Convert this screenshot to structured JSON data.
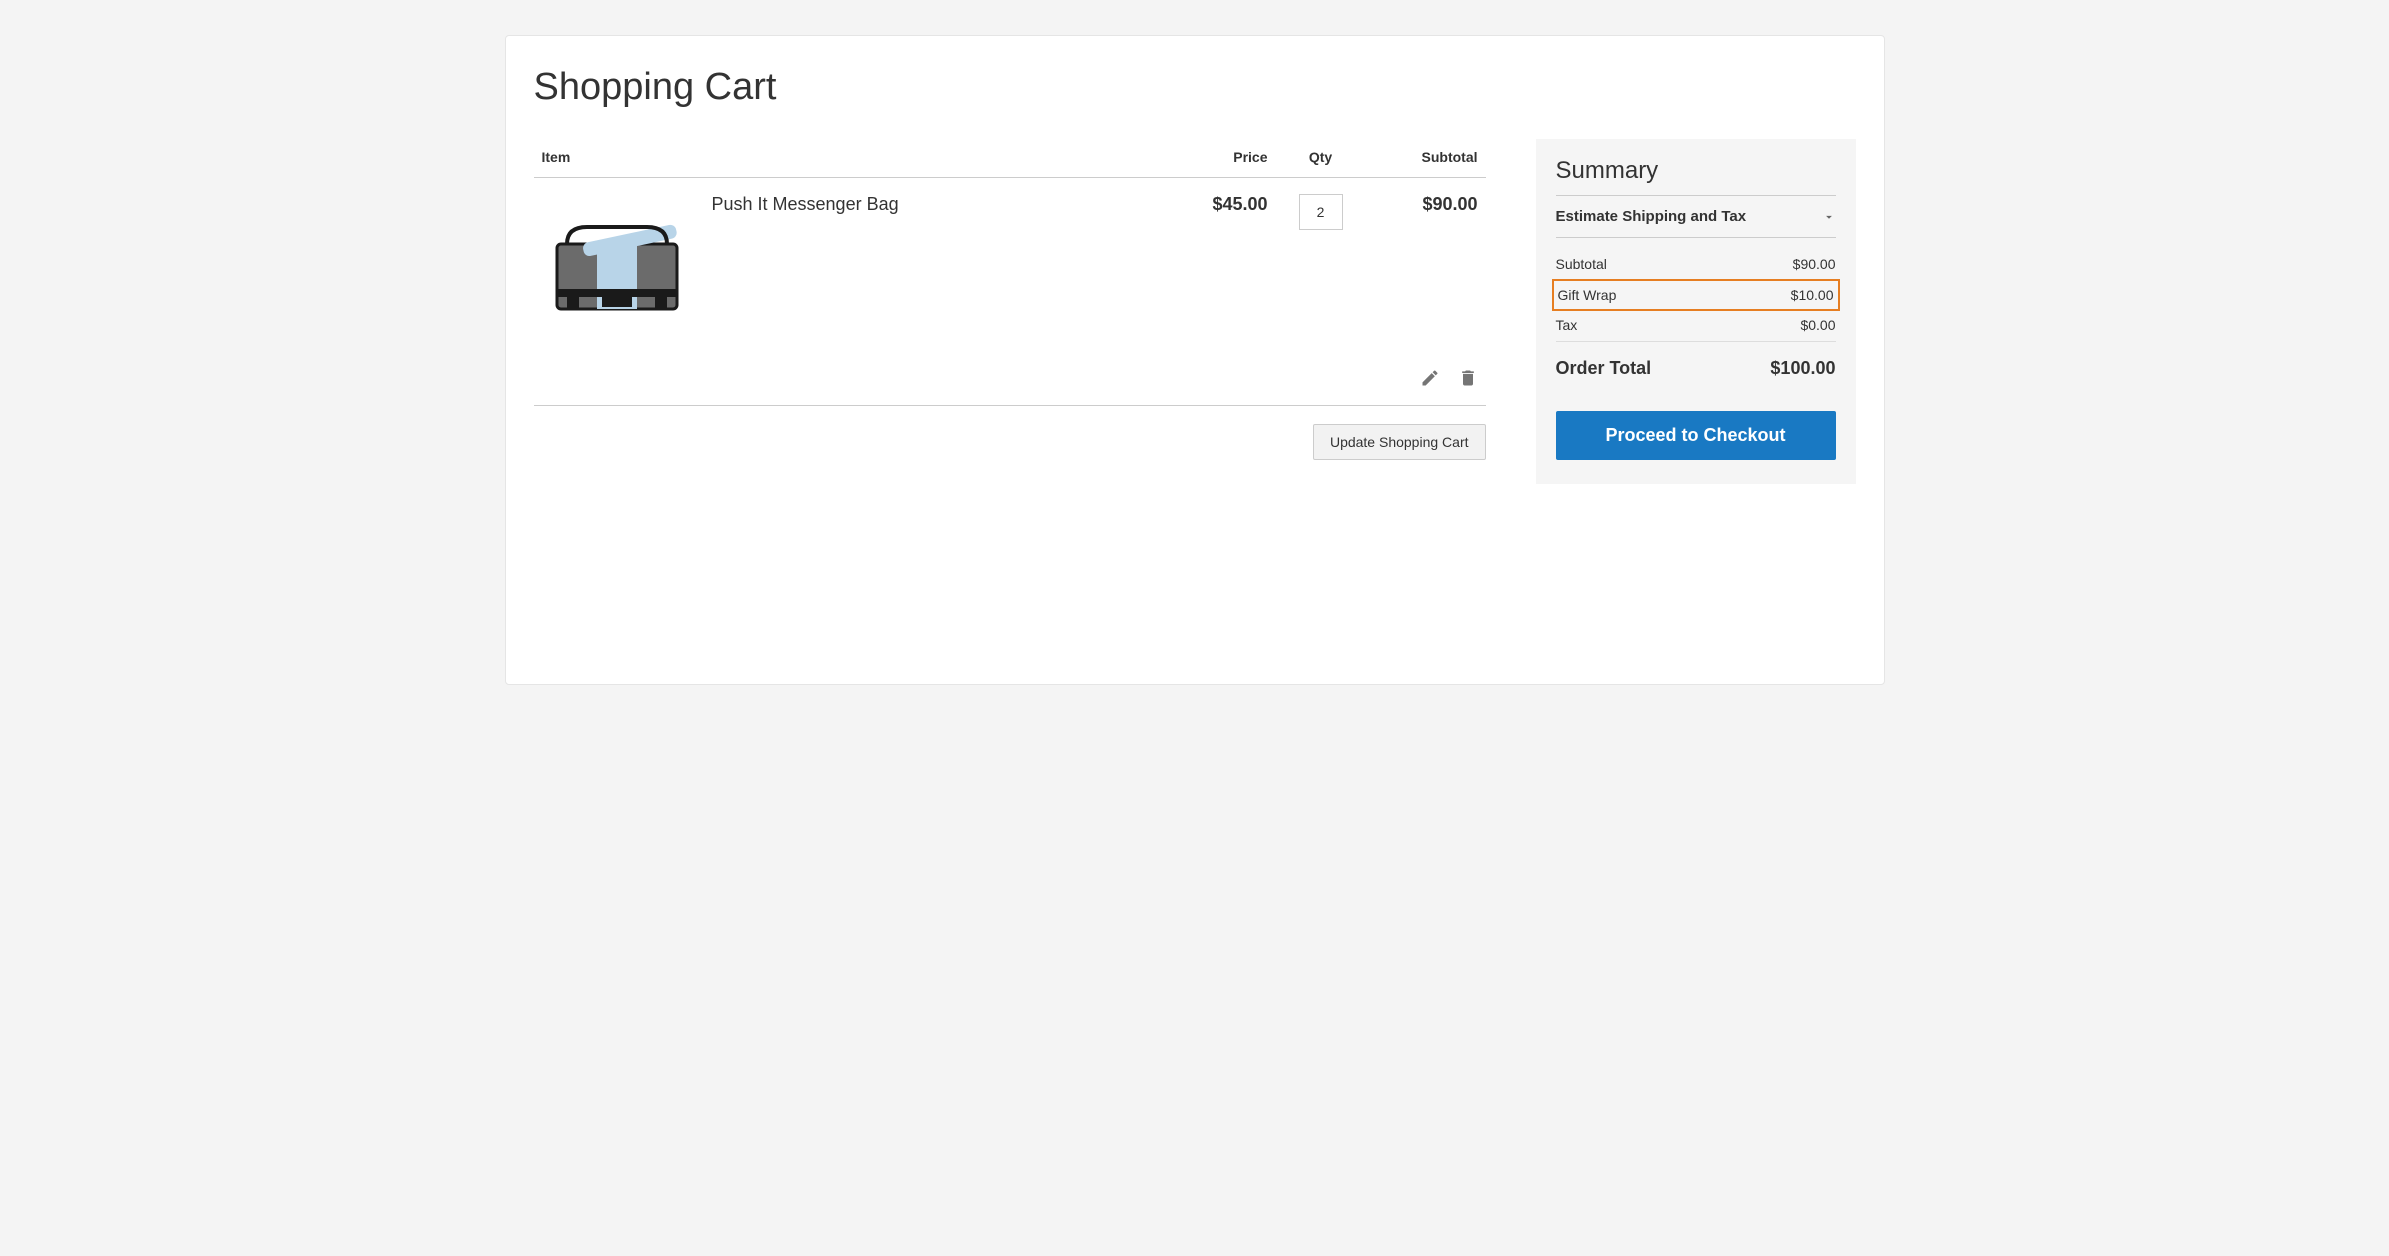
{
  "page": {
    "title": "Shopping Cart"
  },
  "table": {
    "headers": {
      "item": "Item",
      "price": "Price",
      "qty": "Qty",
      "subtotal": "Subtotal"
    },
    "rows": [
      {
        "name": "Push It Messenger Bag",
        "price": "$45.00",
        "qty": "2",
        "subtotal": "$90.00"
      }
    ]
  },
  "actions": {
    "update_cart": "Update Shopping Cart"
  },
  "summary": {
    "title": "Summary",
    "estimate_label": "Estimate Shipping and Tax",
    "lines": {
      "subtotal_label": "Subtotal",
      "subtotal_value": "$90.00",
      "giftwrap_label": "Gift Wrap",
      "giftwrap_value": "$10.00",
      "tax_label": "Tax",
      "tax_value": "$0.00",
      "ordertotal_label": "Order Total",
      "ordertotal_value": "$100.00"
    },
    "checkout_button": "Proceed to Checkout"
  }
}
